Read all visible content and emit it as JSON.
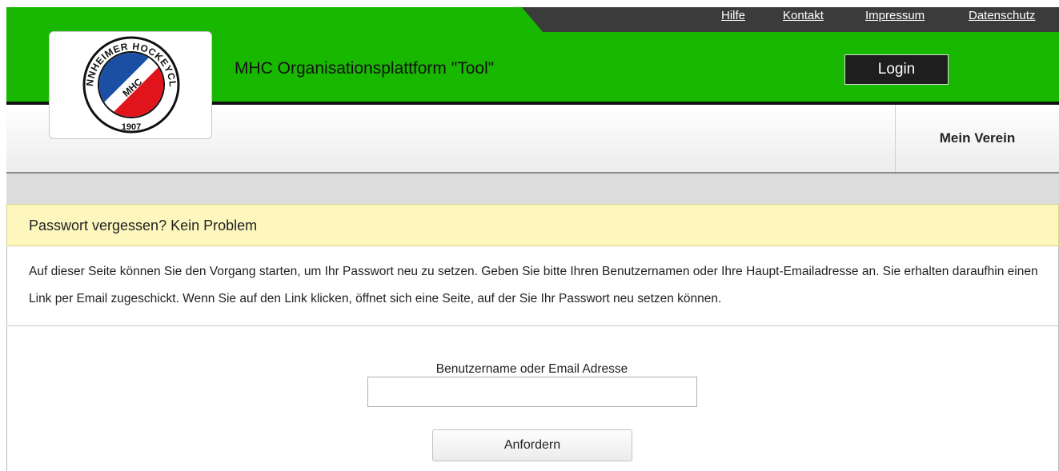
{
  "colors": {
    "header_green": "#18b800",
    "topbar": "#3b3b3b",
    "panel_header": "#fdf7bd",
    "login_button": "#1e1e1e"
  },
  "toplinks": [
    "Hilfe",
    "Kontakt",
    "Impressum",
    "Datenschutz"
  ],
  "logo": {
    "text_arc": "MANNHEIMER HOCKEYCLUB",
    "center": "MHC",
    "year": "1907",
    "icon": "mhc-club-logo"
  },
  "header": {
    "title": "MHC Organisationsplattform \"Tool\"",
    "login_label": "Login"
  },
  "nav": {
    "item": "Mein Verein"
  },
  "panel": {
    "title": "Passwort vergessen? Kein Problem",
    "description": "Auf dieser Seite können Sie den Vorgang starten, um Ihr Passwort neu zu setzen. Geben Sie bitte Ihren Benutzernamen oder Ihre Haupt-Emailadresse an. Sie erhalten daraufhin einen Link per Email zugeschickt. Wenn Sie auf den Link klicken, öffnet sich eine Seite, auf der Sie Ihr Passwort neu setzen können."
  },
  "form": {
    "label": "Benutzername oder Email Adresse",
    "value": "",
    "button": "Anfordern"
  }
}
